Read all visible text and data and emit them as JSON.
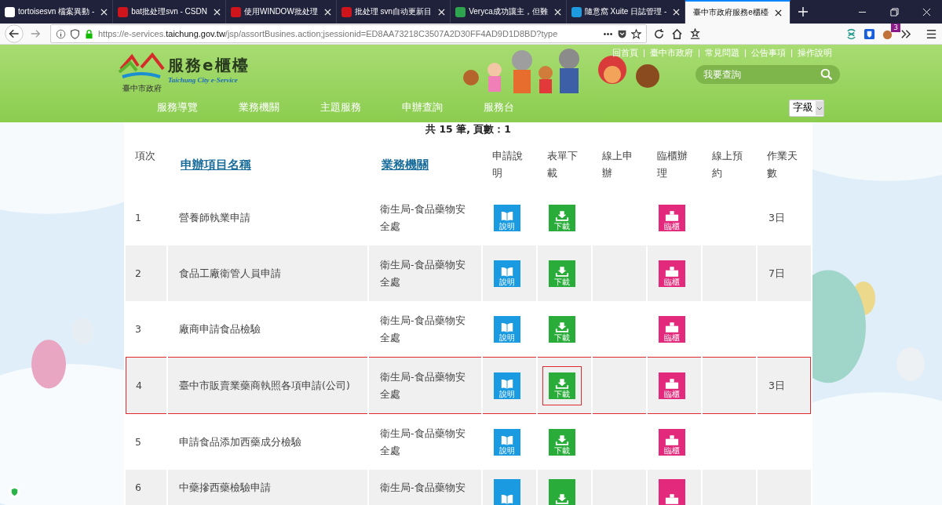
{
  "browser": {
    "tabs": [
      {
        "title": "tortoisesvn 檔案異動 -",
        "selected": false
      },
      {
        "title": "bat批处理svn - CSDN",
        "selected": false
      },
      {
        "title": "使用WINDOW批处理",
        "selected": false
      },
      {
        "title": "批处理 svn自动更新目",
        "selected": false
      },
      {
        "title": "Veryca成功讓主，但難",
        "selected": false
      },
      {
        "title": "隨意窩 Xuite 日誌管理 -",
        "selected": false
      },
      {
        "title": "臺中市政府服務e櫃檯",
        "selected": true
      }
    ],
    "url_prefix": "https://e-services.",
    "url_domain": "taichung.gov.tw",
    "url_rest": "/jsp/assortBusines.action;jsessionid=ED8AA73218C3507A2D30FF4AD9D1D8BD?type",
    "extension_badge": "3"
  },
  "site": {
    "logo_title": "服務e櫃檯",
    "logo_subtitle": "Taichung City e-Service",
    "logo_org": "臺中市政府",
    "top_links": [
      "回首頁",
      "臺中市政府",
      "常見問題",
      "公告事項",
      "操作說明"
    ],
    "search": {
      "placeholder": "我要查詢"
    },
    "nav": [
      "服務導覽",
      "業務機關",
      "主題服務",
      "申辦查詢",
      "服務台"
    ],
    "font_size_select": "字級"
  },
  "summary": "共 15 筆, 頁數：1",
  "table": {
    "columns": [
      {
        "label": "項次",
        "kind": "text"
      },
      {
        "label": "申辦項目名稱",
        "kind": "link"
      },
      {
        "label": "業務機關",
        "kind": "link"
      },
      {
        "label": "申請說明",
        "kind": "text"
      },
      {
        "label": "表單下載",
        "kind": "text"
      },
      {
        "label": "線上申辦",
        "kind": "text"
      },
      {
        "label": "臨櫃辦理",
        "kind": "text"
      },
      {
        "label": "線上預約",
        "kind": "text"
      },
      {
        "label": "作業天數",
        "kind": "text"
      }
    ],
    "rows": [
      {
        "no": "1",
        "name": "營養師執業申請",
        "agency": "衛生局-食品藥物安全處",
        "explain": "說明",
        "download": "下載",
        "counter": "臨櫃",
        "days": "3日",
        "highlighted": false,
        "download_marked": false
      },
      {
        "no": "2",
        "name": "食品工廠衛管人員申請",
        "agency": "衛生局-食品藥物安全處",
        "explain": "說明",
        "download": "下載",
        "counter": "臨櫃",
        "days": "7日",
        "highlighted": false,
        "download_marked": false
      },
      {
        "no": "3",
        "name": "廠商申請食品檢驗",
        "agency": "衛生局-食品藥物安全處",
        "explain": "說明",
        "download": "下載",
        "counter": "臨櫃",
        "highlighted": false,
        "download_marked": false
      },
      {
        "no": "4",
        "name": "臺中市販賣業藥商執照各項申請(公司)",
        "agency": "衛生局-食品藥物安全處",
        "explain": "說明",
        "download": "下載",
        "counter": "臨櫃",
        "days": "3日",
        "highlighted": true,
        "download_marked": true
      },
      {
        "no": "5",
        "name": "申請食品添加西藥成分檢驗",
        "agency": "衛生局-食品藥物安全處",
        "explain": "說明",
        "download": "下載",
        "counter": "臨櫃",
        "highlighted": false,
        "download_marked": false
      },
      {
        "no": "6",
        "name": "中藥摻西藥檢驗申請",
        "agency": "衛生局-食品藥物安",
        "highlighted": false,
        "download_marked": false
      }
    ]
  }
}
